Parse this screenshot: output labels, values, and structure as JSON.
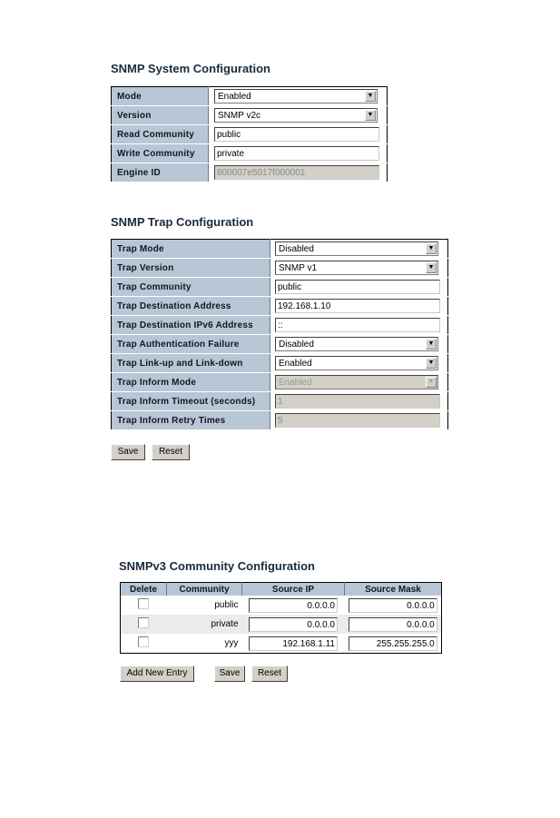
{
  "system": {
    "title": "SNMP System Configuration",
    "rows": [
      {
        "label": "Mode",
        "type": "select",
        "value": "Enabled"
      },
      {
        "label": "Version",
        "type": "select",
        "value": "SNMP v2c"
      },
      {
        "label": "Read Community",
        "type": "input",
        "value": "public"
      },
      {
        "label": "Write Community",
        "type": "input",
        "value": "private"
      },
      {
        "label": "Engine ID",
        "type": "input-disabled",
        "value": "800007e5017f000001"
      }
    ]
  },
  "trap": {
    "title": "SNMP Trap Configuration",
    "rows": [
      {
        "label": "Trap Mode",
        "type": "select",
        "value": "Disabled"
      },
      {
        "label": "Trap Version",
        "type": "select",
        "value": "SNMP v1"
      },
      {
        "label": "Trap Community",
        "type": "input",
        "value": "public"
      },
      {
        "label": "Trap Destination Address",
        "type": "input",
        "value": "192.168.1.10"
      },
      {
        "label": "Trap Destination IPv6 Address",
        "type": "input",
        "value": "::"
      },
      {
        "label": "Trap Authentication Failure",
        "type": "select",
        "value": "Disabled"
      },
      {
        "label": "Trap Link-up and Link-down",
        "type": "select",
        "value": "Enabled"
      },
      {
        "label": "Trap Inform Mode",
        "type": "select-disabled",
        "value": "Enabled"
      },
      {
        "label": "Trap Inform Timeout (seconds)",
        "type": "input-disabled",
        "value": "1"
      },
      {
        "label": "Trap Inform Retry Times",
        "type": "input-disabled",
        "value": "5"
      }
    ],
    "save_label": "Save",
    "reset_label": "Reset"
  },
  "v3": {
    "title": "SNMPv3 Community Configuration",
    "headers": [
      "Delete",
      "Community",
      "Source IP",
      "Source Mask"
    ],
    "rows": [
      {
        "delete": false,
        "community": "public",
        "source_ip": "0.0.0.0",
        "source_mask": "0.0.0.0"
      },
      {
        "delete": false,
        "community": "private",
        "source_ip": "0.0.0.0",
        "source_mask": "0.0.0.0"
      },
      {
        "delete": false,
        "community": "yyy",
        "source_ip": "192.168.1.11",
        "source_mask": "255.255.255.0"
      }
    ],
    "add_label": "Add New Entry",
    "save_label": "Save",
    "reset_label": "Reset"
  },
  "icons": {
    "dropdown": "▼"
  }
}
